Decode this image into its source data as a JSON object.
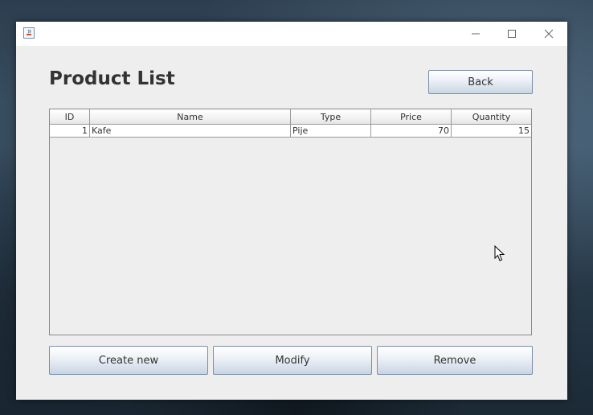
{
  "window": {
    "app_icon": "java-icon",
    "controls": [
      "minimize-icon",
      "maximize-icon",
      "close-icon"
    ]
  },
  "page": {
    "title": "Product List",
    "back_label": "Back"
  },
  "table": {
    "columns": [
      "ID",
      "Name",
      "Type",
      "Price",
      "Quantity"
    ],
    "rows": [
      {
        "id": "1",
        "name": "Kafe",
        "type": "Pije",
        "price": "70",
        "quantity": "15"
      }
    ]
  },
  "actions": {
    "create_label": "Create new",
    "modify_label": "Modify",
    "remove_label": "Remove"
  },
  "colors": {
    "window_bg": "#eeeeee",
    "button_border": "#7a8ea5",
    "text": "#333333"
  }
}
